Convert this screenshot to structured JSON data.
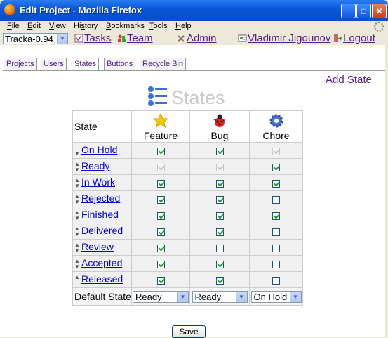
{
  "window": {
    "title": "Edit Project - Mozilla Firefox",
    "min_symbol": "_",
    "max_symbol": "□",
    "close_symbol": "✕"
  },
  "menubar": {
    "items": [
      "File",
      "Edit",
      "View",
      "History",
      "Bookmarks",
      "Tools",
      "Help"
    ],
    "mnemonics": [
      "F",
      "E",
      "V",
      "s",
      "B",
      "T",
      "H"
    ]
  },
  "nav": {
    "project_select": "Tracka-0.94",
    "tasks": "Tasks",
    "team": "Team",
    "admin": "Admin",
    "user": "Vladimir Jigounov",
    "logout": "Logout"
  },
  "tabs": [
    "Projects",
    "Users",
    "States",
    "Buttons",
    "Recycle Bin"
  ],
  "active_tab": "States",
  "add_state": "Add State",
  "page_heading": "States",
  "table": {
    "header_state": "State",
    "columns": [
      {
        "label": "Feature",
        "icon": "star-icon"
      },
      {
        "label": "Bug",
        "icon": "bug-icon"
      },
      {
        "label": "Chore",
        "icon": "gear-icon"
      }
    ],
    "rows": [
      {
        "name": "On Hold",
        "arrows": "down",
        "feature": "checked",
        "bug": "checked",
        "chore": "checked-disabled"
      },
      {
        "name": "Ready",
        "arrows": "up-down",
        "feature": "checked-disabled",
        "bug": "checked-disabled",
        "chore": "checked"
      },
      {
        "name": "In Work",
        "arrows": "up-down",
        "feature": "checked",
        "bug": "checked",
        "chore": "checked"
      },
      {
        "name": "Rejected",
        "arrows": "up-down",
        "feature": "checked",
        "bug": "checked",
        "chore": "unchecked"
      },
      {
        "name": "Finished",
        "arrows": "up-down",
        "feature": "checked",
        "bug": "checked",
        "chore": "checked"
      },
      {
        "name": "Delivered",
        "arrows": "up-down",
        "feature": "checked",
        "bug": "checked",
        "chore": "unchecked"
      },
      {
        "name": "Review",
        "arrows": "up-down",
        "feature": "checked",
        "bug": "unchecked",
        "chore": "unchecked"
      },
      {
        "name": "Accepted",
        "arrows": "up-down",
        "feature": "checked",
        "bug": "checked",
        "chore": "unchecked"
      },
      {
        "name": "Released",
        "arrows": "up",
        "feature": "checked",
        "bug": "checked",
        "chore": "unchecked"
      }
    ],
    "default_label": "Default State",
    "defaults": [
      "Ready",
      "Ready",
      "On Hold"
    ]
  },
  "save_label": "Save"
}
